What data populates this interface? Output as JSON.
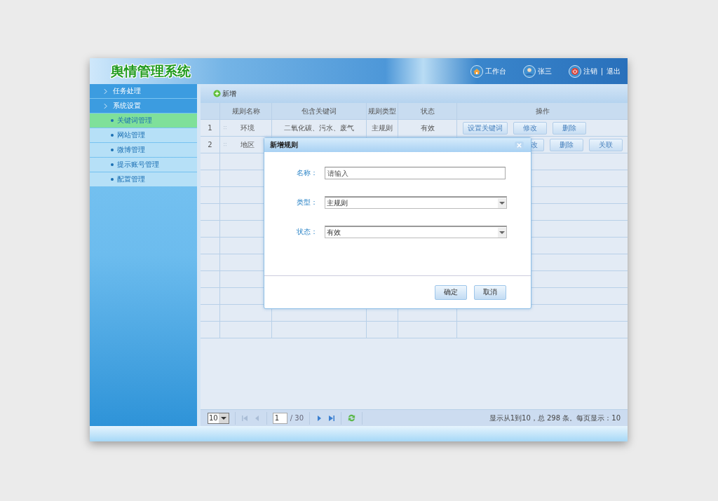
{
  "header": {
    "title": "舆情管理系统",
    "links": [
      {
        "kind": "home",
        "label": "工作台"
      },
      {
        "kind": "user",
        "label": "张三"
      }
    ],
    "logout": {
      "label": "注销",
      "separator": "|",
      "exit": "退出"
    }
  },
  "sidebar": {
    "items": [
      {
        "label": "任务处理"
      },
      {
        "label": "系统设置",
        "children": [
          {
            "label": "关键词管理",
            "selected": true
          },
          {
            "label": "网站管理",
            "selected": false
          },
          {
            "label": "微博管理",
            "selected": false
          },
          {
            "label": "提示账号管理",
            "selected": false
          },
          {
            "label": "配置管理",
            "selected": false
          }
        ]
      }
    ]
  },
  "toolbar": {
    "add": "新增"
  },
  "table": {
    "columns": [
      "规则名称",
      "包含关键词",
      "规则类型",
      "状态",
      "操作"
    ],
    "rows": [
      {
        "num": "1",
        "name": "环境",
        "keywords": "二氧化碳、污水、废气",
        "type": "主规则",
        "status": "有效",
        "actions": [
          "设置关键词",
          "修改",
          "删除"
        ]
      },
      {
        "num": "2",
        "name": "地区",
        "actions": [
          "改",
          "删除",
          "关联"
        ]
      }
    ]
  },
  "pager": {
    "page_size": "10",
    "page": "1",
    "total_pages": "/ 30",
    "info": "显示从1到10，总 298 条。每页显示：10"
  },
  "dialog": {
    "title": "新增规则",
    "fields": [
      {
        "kind": "input",
        "label": "名称：",
        "placeholder": "请输入"
      },
      {
        "kind": "select",
        "label": "类型：",
        "value": "主规则"
      },
      {
        "kind": "select",
        "label": "状态：",
        "value": "有效"
      }
    ],
    "buttons": [
      "确定",
      "取消"
    ]
  }
}
